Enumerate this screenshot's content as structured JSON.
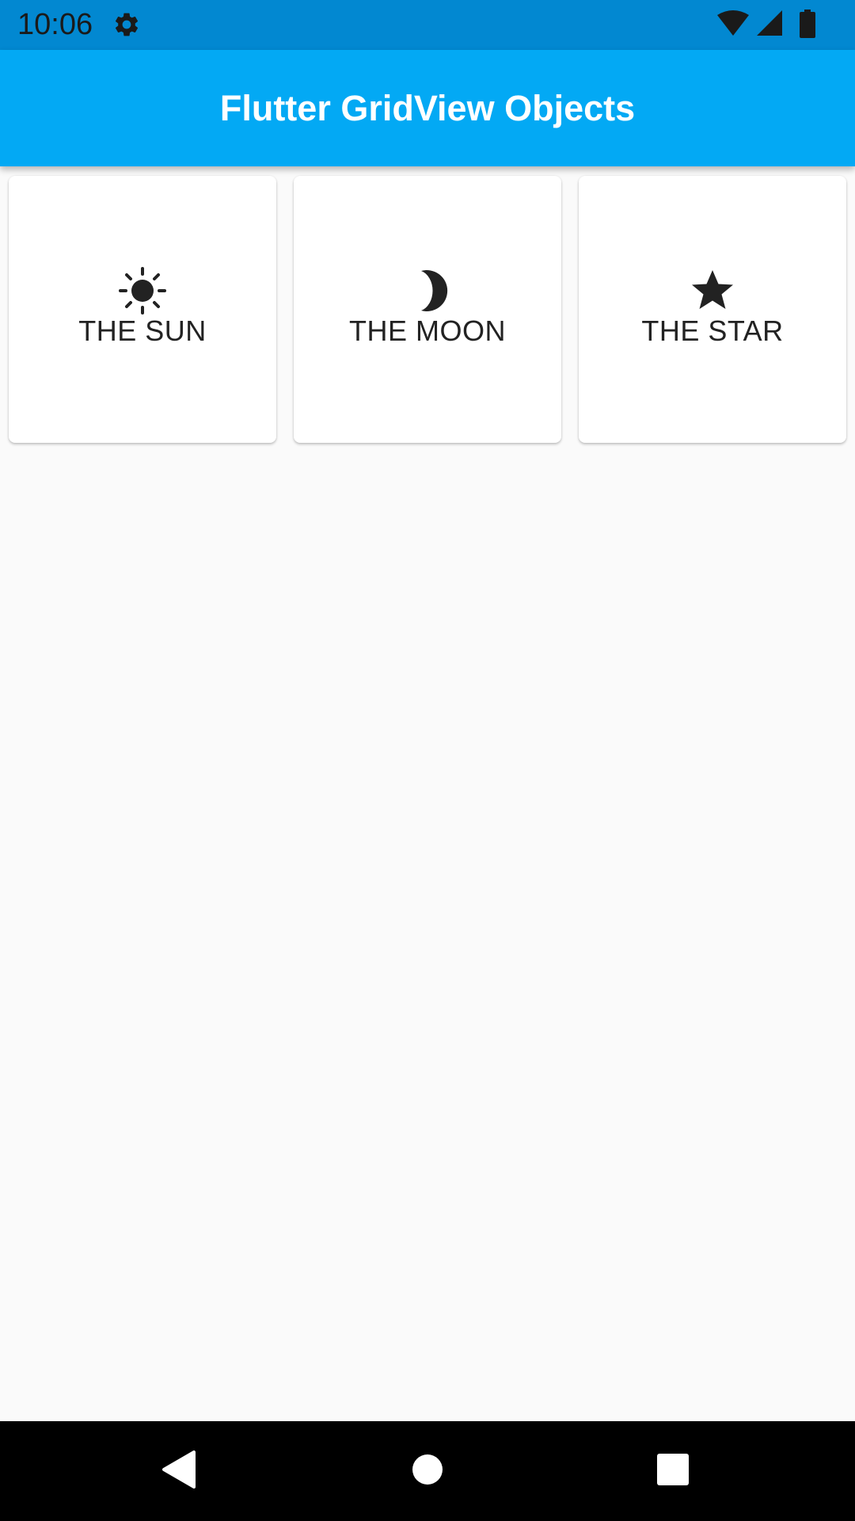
{
  "status_bar": {
    "time": "10:06",
    "icons": [
      "gear-icon",
      "wifi-icon",
      "cell-signal-icon",
      "battery-icon"
    ]
  },
  "app_bar": {
    "title": "Flutter GridView Objects",
    "color": "#03a9f4"
  },
  "grid": {
    "items": [
      {
        "label": "THE SUN",
        "icon": "sun-icon"
      },
      {
        "label": "THE MOON",
        "icon": "moon-icon"
      },
      {
        "label": "THE STAR",
        "icon": "star-icon"
      }
    ]
  },
  "nav_bar": {
    "buttons": [
      "back-icon",
      "home-icon",
      "recents-icon"
    ]
  },
  "colors": {
    "status_bar": "#0288d1",
    "background": "#fafafa"
  }
}
